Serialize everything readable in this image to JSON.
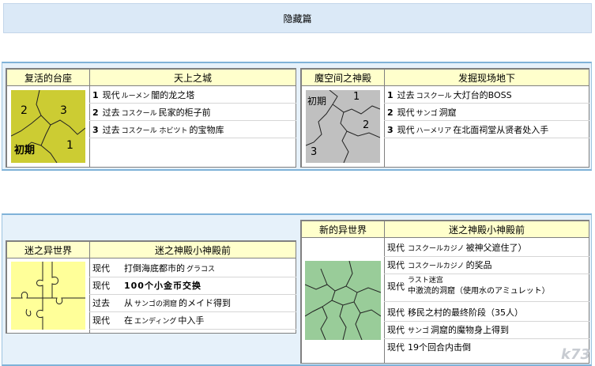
{
  "header": {
    "title": "隐藏篇"
  },
  "section1": {
    "left": {
      "place": "复活的台座",
      "title": "天上之城",
      "puzzle": {
        "pieces": [
          "2",
          "3",
          "1"
        ],
        "initial": "初期",
        "color": "#cccc33"
      },
      "rows": [
        {
          "num": "1",
          "era": "现代",
          "small": "ルーメン",
          "text": "闇的龙之塔"
        },
        {
          "num": "2",
          "era": "过去",
          "small": "コスクール",
          "text": "民家的柜子前"
        },
        {
          "num": "3",
          "era": "过去",
          "small": "コスクール ホビツト",
          "text": "的宝物库"
        }
      ]
    },
    "right": {
      "place": "魔空间之神殿",
      "title": "发掘现场地下",
      "puzzle": {
        "pieces": [
          "1",
          "2",
          "3"
        ],
        "initial": "初期",
        "color": "#c0c0c0"
      },
      "rows": [
        {
          "num": "1",
          "era": "过去",
          "small": "コスクール",
          "text": "大灯台的BOSS"
        },
        {
          "num": "2",
          "era": "现代",
          "small": "サンゴ",
          "text": "洞窟"
        },
        {
          "num": "3",
          "era": "现代",
          "small": "ハーメリア",
          "text": "在北面祠堂从贤者处入手"
        }
      ]
    }
  },
  "section2": {
    "left": {
      "place": "迷之异世界",
      "title": "迷之神殿小神殿前",
      "puzzle": {
        "color": "#ffff99"
      },
      "rows": [
        {
          "era": "现代",
          "text": "打倒海底都市的",
          "small": "グラコス",
          "text2": ""
        },
        {
          "era": "现代",
          "text": "100个小金币交换",
          "small": "",
          "text2": ""
        },
        {
          "era": "过去",
          "text": "从",
          "small": "サンゴの洞窟",
          "text2": "的メイド得到"
        },
        {
          "era": "现代",
          "text": "在",
          "small": "エンディング",
          "text2": "中入手"
        }
      ]
    },
    "right": {
      "place": "新的异世界",
      "title": "迷之神殿小神殿前",
      "puzzle": {
        "color": "#99cc99"
      },
      "rows": [
        {
          "era": "现代",
          "small": "コスクールカジノ",
          "text": "被神父遮住了）"
        },
        {
          "era": "现代",
          "small": "コスクールカジノ",
          "text": "的奖品"
        },
        {
          "era": "现代",
          "small": "ラスト迷宫",
          "text": "中激流的洞窟（使用水のアミュレット）"
        },
        {
          "era": "现代",
          "small": "",
          "text": "移民之村的最终阶段（35人）"
        },
        {
          "era": "现代",
          "small": "サンゴ",
          "text": "洞窟的魔物身上得到"
        },
        {
          "era": "现代",
          "small": "",
          "text": "19个回合内击倒"
        }
      ]
    }
  },
  "watermark": "k73"
}
